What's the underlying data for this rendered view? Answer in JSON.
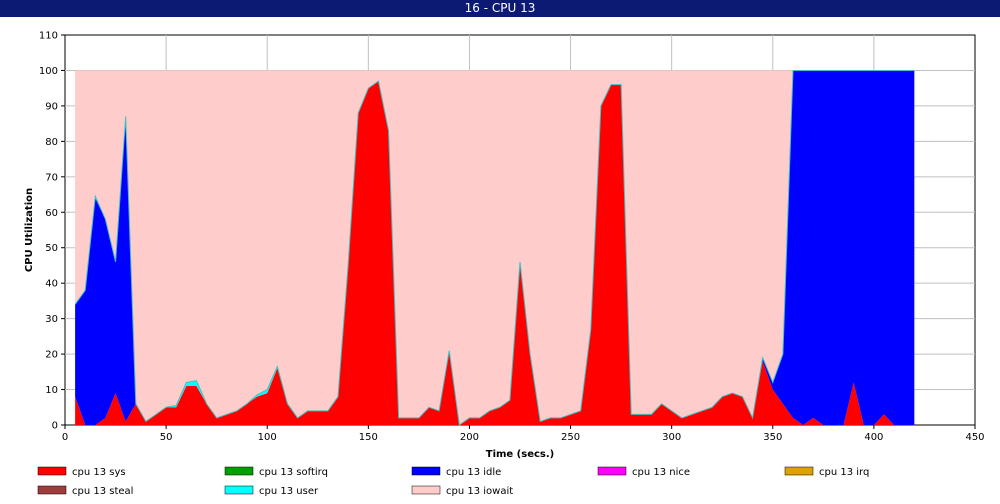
{
  "window": {
    "title": "16 - CPU 13"
  },
  "chart_data": {
    "type": "area",
    "stacked": true,
    "xlabel": "Time (secs.)",
    "ylabel": "CPU Utilization",
    "xlim": [
      0,
      450
    ],
    "ylim": [
      0,
      110
    ],
    "xticks": [
      0,
      50,
      100,
      150,
      200,
      250,
      300,
      350,
      400,
      450
    ],
    "yticks": [
      0,
      10,
      20,
      30,
      40,
      50,
      60,
      70,
      80,
      90,
      100,
      110
    ],
    "grid": true,
    "legend_position": "bottom",
    "colors": {
      "sys": "#ff0000",
      "softirq": "#00a000",
      "idle": "#0000ff",
      "nice": "#ff00ff",
      "irq": "#e0a000",
      "steal": "#a03c3c",
      "user": "#00ffff",
      "iowait": "#ffcccc"
    },
    "x": [
      5,
      10,
      15,
      20,
      25,
      30,
      35,
      40,
      45,
      50,
      55,
      60,
      65,
      70,
      75,
      80,
      85,
      90,
      95,
      100,
      105,
      110,
      115,
      120,
      125,
      130,
      135,
      140,
      145,
      150,
      155,
      160,
      165,
      170,
      175,
      180,
      185,
      190,
      195,
      200,
      205,
      210,
      215,
      220,
      225,
      230,
      235,
      240,
      245,
      250,
      255,
      260,
      265,
      270,
      275,
      280,
      285,
      290,
      295,
      300,
      305,
      310,
      315,
      320,
      325,
      330,
      335,
      340,
      345,
      350,
      355,
      360,
      365,
      370,
      375,
      380,
      385,
      390,
      395,
      400,
      405,
      410,
      415,
      420
    ],
    "series": [
      {
        "name": "cpu 13 sys",
        "key": "sys",
        "values": [
          8,
          0,
          0,
          2,
          9,
          1,
          6,
          1,
          3,
          5,
          5,
          11,
          11,
          6,
          2,
          3,
          4,
          6,
          8,
          9,
          16,
          6,
          2,
          4,
          4,
          4,
          8,
          45,
          88,
          95,
          97,
          83,
          2,
          2,
          2,
          5,
          4,
          21,
          0,
          2,
          2,
          4,
          5,
          7,
          46,
          20,
          1,
          2,
          2,
          3,
          4,
          27,
          90,
          96,
          96,
          3,
          3,
          3,
          6,
          4,
          2,
          3,
          4,
          5,
          8,
          9,
          8,
          2,
          18,
          10,
          6,
          2,
          0,
          2,
          0,
          0,
          0,
          12,
          0,
          0,
          3,
          0,
          0,
          0
        ]
      },
      {
        "name": "cpu 13 softirq",
        "key": "softirq",
        "values": [
          0,
          0,
          0,
          0,
          0,
          0,
          0,
          0,
          0,
          0,
          0,
          0,
          0,
          0,
          0,
          0,
          0,
          0,
          0,
          0,
          0,
          0,
          0,
          0,
          0,
          0,
          0,
          0,
          0,
          0,
          0,
          0,
          0,
          0,
          0,
          0,
          0,
          0,
          0,
          0,
          0,
          0,
          0,
          0,
          0,
          0,
          0,
          0,
          0,
          0,
          0,
          0,
          0,
          0,
          0,
          0,
          0,
          0,
          0,
          0,
          0,
          0,
          0,
          0,
          0,
          0,
          0,
          0,
          0,
          0,
          0,
          0,
          0,
          0,
          0,
          0,
          0,
          0,
          0,
          0,
          0,
          0,
          0,
          0
        ]
      },
      {
        "name": "cpu 13 idle",
        "key": "idle",
        "values": [
          26,
          38,
          64,
          56,
          37,
          86,
          0,
          0,
          0,
          0,
          0,
          0,
          0,
          0,
          0,
          0,
          0,
          0,
          0,
          0,
          0,
          0,
          0,
          0,
          0,
          0,
          0,
          0,
          0,
          0,
          0,
          0,
          0,
          0,
          0,
          0,
          0,
          0,
          0,
          0,
          0,
          0,
          0,
          0,
          0,
          0,
          0,
          0,
          0,
          0,
          0,
          0,
          0,
          0,
          0,
          0,
          0,
          0,
          0,
          0,
          0,
          0,
          0,
          0,
          0,
          0,
          0,
          0,
          1,
          2,
          14,
          98,
          100,
          98,
          100,
          100,
          100,
          88,
          100,
          100,
          97,
          100,
          100,
          100
        ]
      },
      {
        "name": "cpu 13 nice",
        "key": "nice",
        "values": [
          0,
          0,
          0,
          0,
          0,
          0,
          0,
          0,
          0,
          0,
          0,
          0,
          0,
          0,
          0,
          0,
          0,
          0,
          0,
          0,
          0,
          0,
          0,
          0,
          0,
          0,
          0,
          0,
          0,
          0,
          0,
          0,
          0,
          0,
          0,
          0,
          0,
          0,
          0,
          0,
          0,
          0,
          0,
          0,
          0,
          0,
          0,
          0,
          0,
          0,
          0,
          0,
          0,
          0,
          0,
          0,
          0,
          0,
          0,
          0,
          0,
          0,
          0,
          0,
          0,
          0,
          0,
          0,
          0,
          0,
          0,
          0,
          0,
          0,
          0,
          0,
          0,
          0,
          0,
          0,
          0,
          0,
          0,
          0
        ]
      },
      {
        "name": "cpu 13 irq",
        "key": "irq",
        "values": [
          0,
          0,
          0,
          0,
          0,
          0,
          0,
          0,
          0,
          0,
          0,
          0,
          0,
          0,
          0,
          0,
          0,
          0,
          0,
          0,
          0,
          0,
          0,
          0,
          0,
          0,
          0,
          0,
          0,
          0,
          0,
          0,
          0,
          0,
          0,
          0,
          0,
          0,
          0,
          0,
          0,
          0,
          0,
          0,
          0,
          0,
          0,
          0,
          0,
          0,
          0,
          0,
          0,
          0,
          0,
          0,
          0,
          0,
          0,
          0,
          0,
          0,
          0,
          0,
          0,
          0,
          0,
          0,
          0,
          0,
          0,
          0,
          0,
          0,
          0,
          0,
          0,
          0,
          0,
          0,
          0,
          0,
          0,
          0
        ]
      },
      {
        "name": "cpu 13 steal",
        "key": "steal",
        "values": [
          0,
          0,
          0,
          0,
          0,
          0,
          0,
          0,
          0,
          0,
          0,
          0,
          0,
          0,
          0,
          0,
          0,
          0,
          0,
          0,
          0,
          0,
          0,
          0,
          0,
          0,
          0,
          0,
          0,
          0,
          0,
          0,
          0,
          0,
          0,
          0,
          0,
          0,
          0,
          0,
          0,
          0,
          0,
          0,
          0,
          0,
          0,
          0,
          0,
          0,
          0,
          0,
          0,
          0,
          0,
          0,
          0,
          0,
          0,
          0,
          0,
          0,
          0,
          0,
          0,
          0,
          0,
          0,
          0,
          0,
          0,
          0,
          0,
          0,
          0,
          0,
          0,
          0,
          0,
          0,
          0,
          0,
          0,
          0
        ]
      },
      {
        "name": "cpu 13 user",
        "key": "user",
        "values": [
          0,
          0,
          0.5,
          0,
          0,
          0,
          0,
          0,
          0,
          0,
          0.5,
          1,
          1.5,
          0,
          0,
          0,
          0,
          0,
          0.5,
          1,
          0.5,
          0,
          0,
          0,
          0,
          0,
          0,
          0,
          0,
          0,
          0,
          0,
          0,
          0,
          0,
          0,
          0,
          0,
          0,
          0,
          0,
          0,
          0,
          0,
          0,
          0,
          0,
          0,
          0,
          0,
          0,
          0,
          0,
          0,
          0,
          0,
          0,
          0,
          0,
          0,
          0,
          0,
          0,
          0,
          0,
          0,
          0,
          0,
          0,
          0,
          0,
          0,
          0,
          0,
          0,
          0,
          0,
          0,
          0,
          0,
          0,
          0,
          0,
          0
        ]
      },
      {
        "name": "cpu 13 iowait",
        "key": "iowait",
        "values": [
          66,
          62,
          35.5,
          42,
          54,
          13,
          94,
          99,
          97,
          95,
          94.5,
          88,
          87.5,
          94,
          98,
          97,
          96,
          94,
          91.5,
          90,
          83.5,
          94,
          98,
          96,
          96,
          96,
          92,
          55,
          12,
          5,
          3,
          17,
          98,
          98,
          98,
          95,
          96,
          79,
          100,
          98,
          98,
          96,
          95,
          93,
          54,
          80,
          99,
          98,
          98,
          97,
          96,
          73,
          10,
          4,
          4,
          97,
          97,
          97,
          94,
          96,
          98,
          97,
          96,
          95,
          92,
          91,
          92,
          98,
          81,
          88,
          80,
          0,
          0,
          0,
          0,
          0,
          0,
          0,
          0,
          0,
          0,
          0,
          0,
          0
        ]
      }
    ]
  }
}
